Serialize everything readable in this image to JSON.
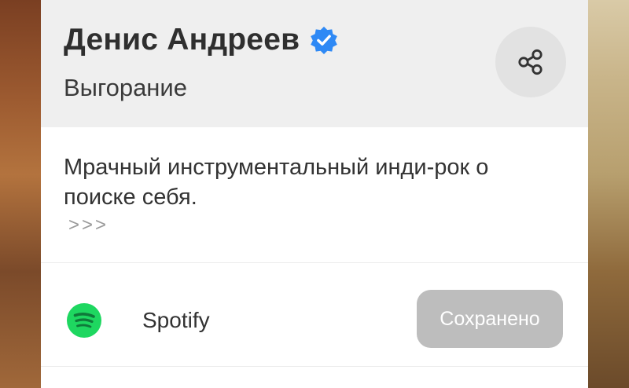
{
  "header": {
    "artist": "Денис Андреев",
    "album": "Выгорание"
  },
  "icons": {
    "verified": "verified-badge-icon",
    "share": "share-icon",
    "service": "spotify-icon"
  },
  "description": {
    "text": "Мрачный инструментальный инди-рок о поиске себя.",
    "more": ">>>"
  },
  "services": [
    {
      "name": "Spotify",
      "button_label": "Сохранено"
    }
  ],
  "colors": {
    "verified_blue": "#2e89f5",
    "spotify_green": "#1ed760",
    "saved_button": "#bdbdbd"
  }
}
